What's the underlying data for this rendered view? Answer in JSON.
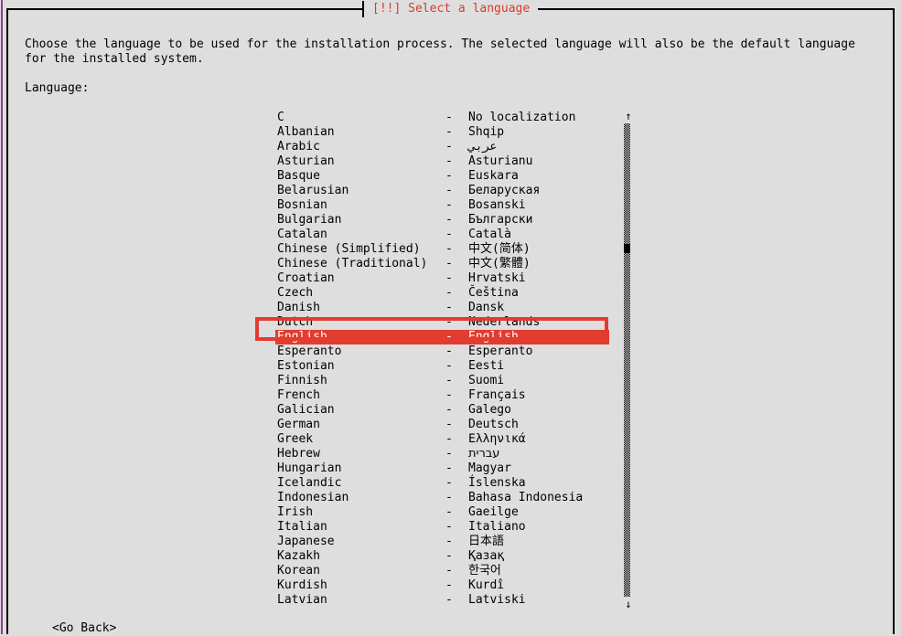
{
  "window": {
    "title": "[!!] Select a language",
    "title_color": "#d93a2b",
    "background_color": "#dedede",
    "border_color": "#000000",
    "terminal_edge_color": "#8f3f8f"
  },
  "content": {
    "intro_text": "Choose the language to be used for the installation process. The selected language will also be the default language\nfor the installed system.",
    "language_label": "Language:"
  },
  "list": {
    "separator": "-",
    "selected_index": 15,
    "selection_background": "#e23b30",
    "selection_foreground": "#ffffff",
    "annotation_color": "#e23b30",
    "items": [
      {
        "name": "C",
        "native": "No localization"
      },
      {
        "name": "Albanian",
        "native": "Shqip"
      },
      {
        "name": "Arabic",
        "native": "عربي"
      },
      {
        "name": "Asturian",
        "native": "Asturianu"
      },
      {
        "name": "Basque",
        "native": "Euskara"
      },
      {
        "name": "Belarusian",
        "native": "Беларуская"
      },
      {
        "name": "Bosnian",
        "native": "Bosanski"
      },
      {
        "name": "Bulgarian",
        "native": "Български"
      },
      {
        "name": "Catalan",
        "native": "Català"
      },
      {
        "name": "Chinese (Simplified)",
        "native": "中文(简体)"
      },
      {
        "name": "Chinese (Traditional)",
        "native": "中文(繁體)"
      },
      {
        "name": "Croatian",
        "native": "Hrvatski"
      },
      {
        "name": "Czech",
        "native": "Čeština"
      },
      {
        "name": "Danish",
        "native": "Dansk"
      },
      {
        "name": "Dutch",
        "native": "Nederlands"
      },
      {
        "name": "English",
        "native": "English"
      },
      {
        "name": "Esperanto",
        "native": "Esperanto"
      },
      {
        "name": "Estonian",
        "native": "Eesti"
      },
      {
        "name": "Finnish",
        "native": "Suomi"
      },
      {
        "name": "French",
        "native": "Français"
      },
      {
        "name": "Galician",
        "native": "Galego"
      },
      {
        "name": "German",
        "native": "Deutsch"
      },
      {
        "name": "Greek",
        "native": "Ελληνικά"
      },
      {
        "name": "Hebrew",
        "native": "עברית"
      },
      {
        "name": "Hungarian",
        "native": "Magyar"
      },
      {
        "name": "Icelandic",
        "native": "Íslenska"
      },
      {
        "name": "Indonesian",
        "native": "Bahasa Indonesia"
      },
      {
        "name": "Irish",
        "native": "Gaeilge"
      },
      {
        "name": "Italian",
        "native": "Italiano"
      },
      {
        "name": "Japanese",
        "native": "日本語"
      },
      {
        "name": "Kazakh",
        "native": "Қазақ"
      },
      {
        "name": "Korean",
        "native": "한국어"
      },
      {
        "name": "Kurdish",
        "native": "Kurdî"
      },
      {
        "name": "Latvian",
        "native": "Latviski"
      }
    ]
  },
  "scrollbar": {
    "up_arrow": "↑",
    "down_arrow": "↓"
  },
  "footer": {
    "go_back_label": "<Go Back>"
  }
}
